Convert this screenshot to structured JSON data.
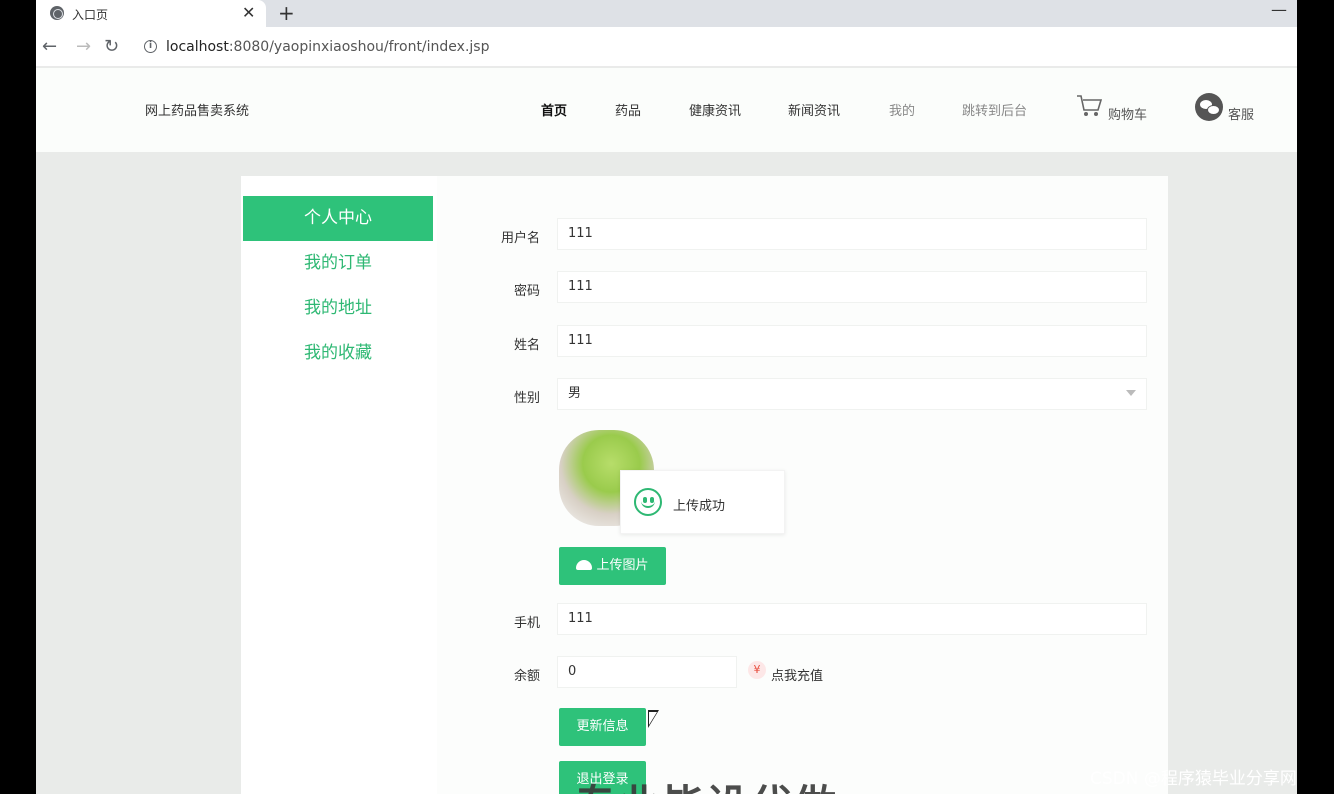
{
  "browser": {
    "tab_title": "入口页",
    "tab_close": "✕",
    "new_tab": "+",
    "minimize": "—",
    "back": "←",
    "forward": "→",
    "reload": "↻",
    "url_host": "localhost",
    "url_rest": ":8080/yaopinxiaoshou/front/index.jsp"
  },
  "header": {
    "site_title": "网上药品售卖系统",
    "nav": [
      "首页",
      "药品",
      "健康资讯",
      "新闻资讯",
      "我的",
      "跳转到后台"
    ],
    "cart_label": "购物车",
    "service_label": "客服"
  },
  "sidebar": {
    "items": [
      "个人中心",
      "我的订单",
      "我的地址",
      "我的收藏"
    ]
  },
  "form": {
    "username_label": "用户名",
    "username_value": "111",
    "password_label": "密码",
    "password_value": "111",
    "name_label": "姓名",
    "name_value": "111",
    "gender_label": "性别",
    "gender_value": "男",
    "upload_button": "上传图片",
    "phone_label": "手机",
    "phone_value": "111",
    "balance_label": "余额",
    "balance_value": "0",
    "recharge_icon": "¥",
    "recharge_text": "点我充值",
    "update_button": "更新信息",
    "logout_button": "退出登录"
  },
  "toast": {
    "message": "上传成功"
  },
  "overlay": {
    "text": "专业毕设代做",
    "watermark": "CSDN @程序猿毕业分享网"
  },
  "colors": {
    "accent": "#2ec27a",
    "accent_text": "#2eb873"
  }
}
